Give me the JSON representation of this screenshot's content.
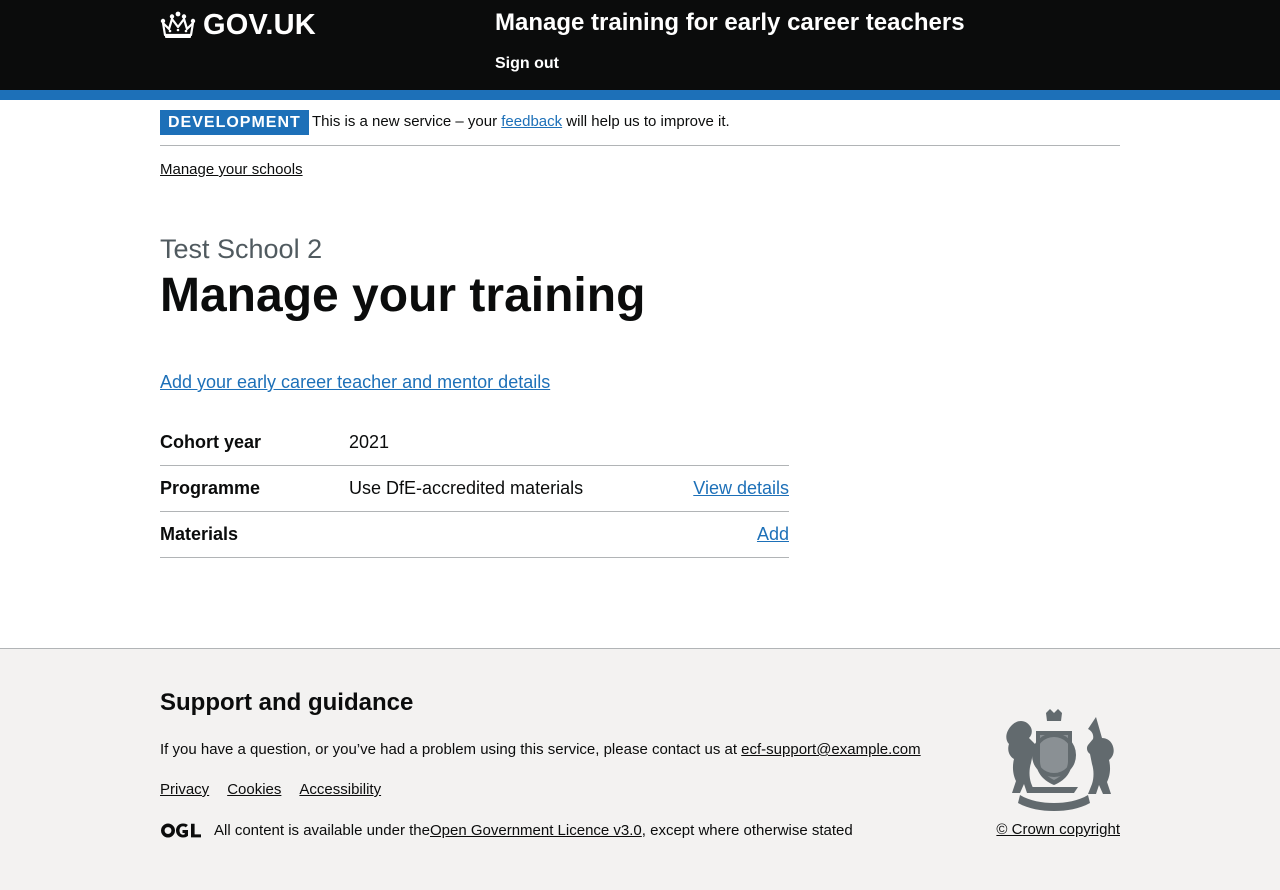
{
  "header": {
    "logo_text": "GOV.UK",
    "service_name": "Manage training for early career teachers",
    "signout_label": "Sign out"
  },
  "phase": {
    "tag": "DEVELOPMENT",
    "text_before": "This is a new service – your ",
    "link_text": "feedback",
    "text_after": " will help us to improve it."
  },
  "breadcrumb": {
    "link": "Manage your schools"
  },
  "page": {
    "caption": "Test School 2",
    "title": "Manage your training",
    "add_details_link": "Add your early career teacher and mentor details"
  },
  "summary": {
    "rows": [
      {
        "key": "Cohort year",
        "value": "2021",
        "action": ""
      },
      {
        "key": "Programme",
        "value": "Use DfE-accredited materials",
        "action": "View details"
      },
      {
        "key": "Materials",
        "value": "",
        "action": "Add"
      }
    ]
  },
  "footer": {
    "heading": "Support and guidance",
    "contact_text": "If you have a question, or you’ve had a problem using this service, please contact us at ",
    "contact_email": "ecf-support@example.com",
    "links": [
      "Privacy",
      "Cookies",
      "Accessibility"
    ],
    "licence_before": "All content is available under the ",
    "licence_link": "Open Government Licence v3.0",
    "licence_after": ", except where otherwise stated",
    "copyright": "© Crown copyright"
  },
  "colors": {
    "header_bg": "#0b0c0c",
    "accent_blue": "#1d70b8",
    "footer_bg": "#f3f2f1",
    "text": "#0b0c0c",
    "secondary_text": "#505a5f"
  },
  "icons": {
    "logo": "crown-icon",
    "licence": "ogl-logo-icon",
    "crest": "royal-coat-of-arms-icon"
  }
}
